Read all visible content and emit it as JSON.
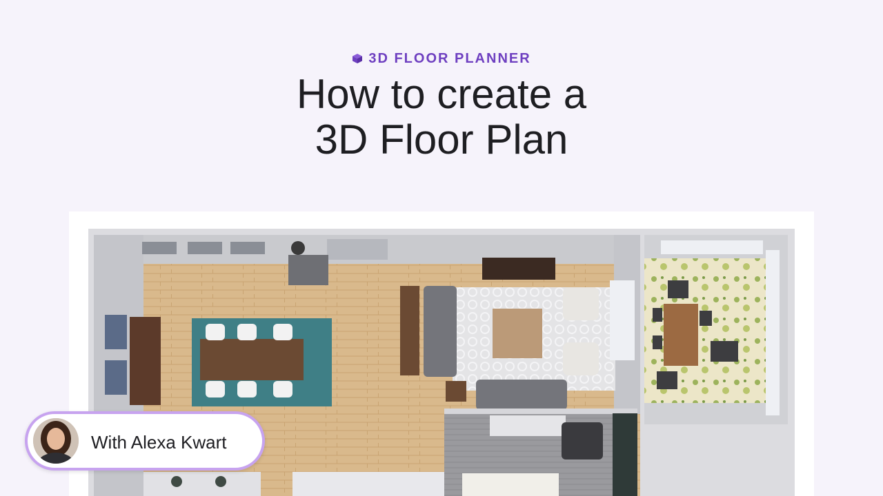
{
  "header": {
    "eyebrow": "3D FLOOR PLANNER",
    "eyebrow_icon": "cube-icon",
    "title_line1": "How to create a",
    "title_line2": "3D Floor Plan"
  },
  "presenter": {
    "label": "With Alexa Kwart",
    "avatar": "presenter-avatar"
  },
  "colors": {
    "accent": "#6e3fc0",
    "badge_border": "#c7a3ef",
    "background": "#f6f3fb",
    "title": "#1e1e22"
  }
}
